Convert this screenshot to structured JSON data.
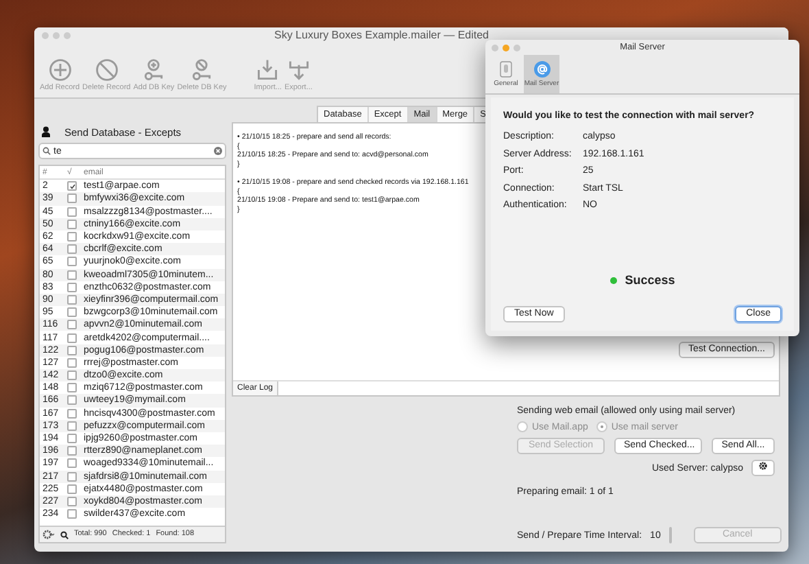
{
  "window": {
    "title": "Sky Luxury Boxes Example.mailer — Edited"
  },
  "toolbar": [
    {
      "label": "Add Record",
      "kind": "add"
    },
    {
      "label": "Delete Record",
      "kind": "delete"
    },
    {
      "label": "Add DB Key",
      "kind": "add-key"
    },
    {
      "label": "Delete DB Key",
      "kind": "delete-key"
    },
    {
      "label": "Import...",
      "kind": "import"
    },
    {
      "label": "Export...",
      "kind": "export"
    }
  ],
  "tabs": [
    {
      "label": "Database",
      "selected": false
    },
    {
      "label": "Except",
      "selected": false
    },
    {
      "label": "Mail",
      "selected": true
    },
    {
      "label": "Merge",
      "selected": false
    },
    {
      "label": "S",
      "selected": false
    }
  ],
  "database_panel": {
    "title": "Send Database - Excepts",
    "search": {
      "value": "te"
    },
    "columns": [
      "#",
      "√",
      "email"
    ],
    "rows": [
      {
        "id": "2",
        "checked": true,
        "email": "test1@arpae.com"
      },
      {
        "id": "39",
        "checked": false,
        "email": "bmfywxi36@excite.com"
      },
      {
        "id": "45",
        "checked": false,
        "email": "msalzzzg8134@postmaster...."
      },
      {
        "id": "50",
        "checked": false,
        "email": "ctniny166@excite.com"
      },
      {
        "id": "62",
        "checked": false,
        "email": "kocrkdxw91@excite.com"
      },
      {
        "id": "64",
        "checked": false,
        "email": "cbcrlf@excite.com"
      },
      {
        "id": "65",
        "checked": false,
        "email": "yuurjnok0@excite.com"
      },
      {
        "id": "80",
        "checked": false,
        "email": "kweoadml7305@10minutem..."
      },
      {
        "id": "83",
        "checked": false,
        "email": "enzthc0632@postmaster.com"
      },
      {
        "id": "90",
        "checked": false,
        "email": "xieyfinr396@computermail.com"
      },
      {
        "id": "95",
        "checked": false,
        "email": "bzwgcorp3@10minutemail.com"
      },
      {
        "id": "116",
        "checked": false,
        "email": "apvvn2@10minutemail.com"
      },
      {
        "id": "117",
        "checked": false,
        "email": "aretdk4202@computermail...."
      },
      {
        "id": "122",
        "checked": false,
        "email": "pogug106@postmaster.com"
      },
      {
        "id": "127",
        "checked": false,
        "email": "rrrej@postmaster.com"
      },
      {
        "id": "142",
        "checked": false,
        "email": "dtzo0@excite.com"
      },
      {
        "id": "148",
        "checked": false,
        "email": "mziq6712@postmaster.com"
      },
      {
        "id": "166",
        "checked": false,
        "email": "uwteey19@mymail.com"
      },
      {
        "id": "167",
        "checked": false,
        "email": "hncisqv4300@postmaster.com"
      },
      {
        "id": "173",
        "checked": false,
        "email": "pefuzzx@computermail.com"
      },
      {
        "id": "194",
        "checked": false,
        "email": "ipjg9260@postmaster.com"
      },
      {
        "id": "196",
        "checked": false,
        "email": "rtterz890@nameplanet.com"
      },
      {
        "id": "197",
        "checked": false,
        "email": "woaged9334@10minutemail..."
      },
      {
        "id": "217",
        "checked": false,
        "email": "sjafdrsi8@10minutemail.com"
      },
      {
        "id": "225",
        "checked": false,
        "email": "ejatx4480@postmaster.com"
      },
      {
        "id": "227",
        "checked": false,
        "email": "xoykd804@postmaster.com"
      },
      {
        "id": "234",
        "checked": false,
        "email": "swilder437@excite.com"
      }
    ],
    "footer": {
      "total": "Total: 990",
      "checked": "Checked: 1",
      "found": "Found: 108"
    }
  },
  "log": {
    "entries": [
      {
        "lines": [
          "• 21/10/15 18:25 - prepare and send all records:",
          "{",
          "21/10/15 18:25 - Prepare and send to: acvd@personal.com",
          "}"
        ]
      },
      {
        "lines": [
          "• 21/10/15 19:08 - prepare and send checked records via 192.168.1.161",
          "{",
          "21/10/15 19:08 - Prepare and send to: test1@arpae.com",
          "}"
        ]
      }
    ],
    "clear_button": "Clear Log"
  },
  "test_connection_button": "Test Connection...",
  "sending": {
    "heading": "Sending web email (allowed only using mail server)",
    "radios": [
      {
        "label": "Use Mail.app",
        "selected": false,
        "disabled": true
      },
      {
        "label": "Use mail server",
        "selected": true,
        "disabled": true
      }
    ],
    "buttons": [
      {
        "label": "Send Selection",
        "disabled": true
      },
      {
        "label": "Send Checked...",
        "disabled": false
      },
      {
        "label": "Send All...",
        "disabled": false
      }
    ],
    "used_server": "Used Server: calypso",
    "status": "Preparing email: 1 of 1",
    "interval_label": "Send / Prepare Time Interval:",
    "interval_value": "10",
    "cancel": {
      "label": "Cancel",
      "disabled": true
    }
  },
  "dialog": {
    "title": "Mail Server",
    "tabs": [
      {
        "label": "General",
        "selected": false,
        "kind": "general"
      },
      {
        "label": "Mail Server",
        "selected": true,
        "kind": "at"
      }
    ],
    "question": "Would you like to test the connection with mail server?",
    "fields": [
      {
        "label": "Description:",
        "value": "calypso"
      },
      {
        "label": "Server Address:",
        "value": "192.168.1.161"
      },
      {
        "label": "Port:",
        "value": "25"
      },
      {
        "label": "Connection:",
        "value": "Start TSL"
      },
      {
        "label": "Authentication:",
        "value": "NO"
      }
    ],
    "status": {
      "kind": "success",
      "text": "Success"
    },
    "buttons": [
      {
        "label": "Test Now",
        "default": false
      },
      {
        "label": "Close",
        "default": true
      }
    ]
  }
}
